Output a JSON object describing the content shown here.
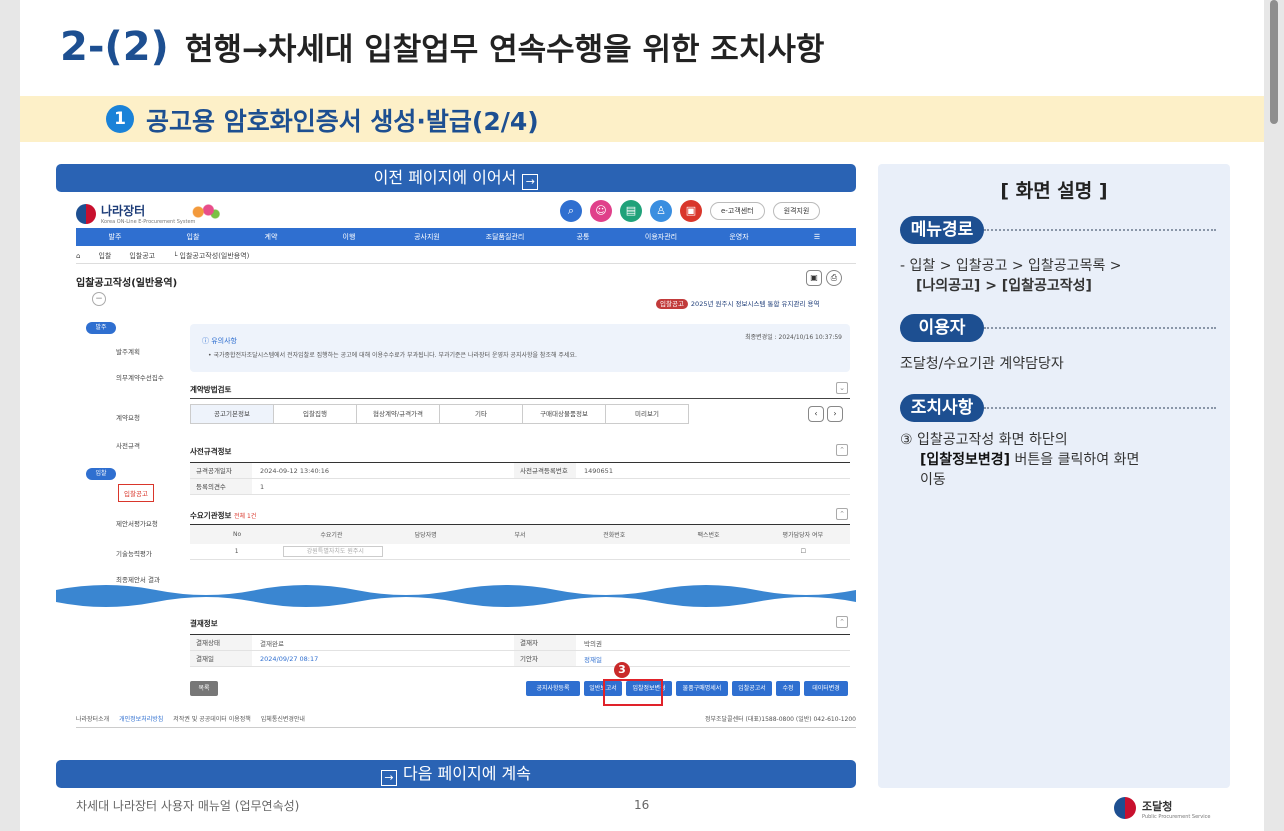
{
  "slide": {
    "number": "2-(2)",
    "title": "현행→차세대 입찰업무 연속수행을 위한 조치사항",
    "subtitle_badge": "1",
    "subtitle": "공고용 암호화인증서 생성·발급(2/4)",
    "banner_top": "이전 페이지에 이어서",
    "banner_top_icon": "→",
    "banner_bottom": "다음 페이지에 계속",
    "banner_bottom_icon": "→",
    "footer_left": "차세대 나라장터 사용자 매뉴얼 (업무연속성)",
    "page_number": "16",
    "footer_logo_name": "조달청",
    "footer_logo_sub": "Public Procurement Service"
  },
  "screen": {
    "logo_name": "나라장터",
    "logo_sub": "Korea ON-Line E-Procurement System",
    "top_pills": [
      "e-고객센터",
      "원격지원"
    ],
    "nav": [
      "발주",
      "입찰",
      "계약",
      "이행",
      "공사지원",
      "조달품질관리",
      "공통",
      "이용자관리",
      "운영자",
      "☰"
    ],
    "crumb": [
      "입찰",
      "입찰공고",
      "└ 입찰공고작성(일반용역)"
    ],
    "page_title": "입찰공고작성(일반용역)",
    "tag": "입찰공고",
    "tag_text": "2025년 원주시 정보시스템 통합 유지관리 용역",
    "sidebar": {
      "cat1": "발주",
      "items1": [
        "발주계획",
        "의무계약수선집수",
        "계약요청",
        "사전규격"
      ],
      "cat2": "입찰",
      "active": "입찰공고",
      "items2": [
        "제안서평가요청",
        "기술능력평가",
        "최종제안서 결과"
      ]
    },
    "notice_title": "유의사항",
    "notice_body": "• 국가종합전자조달시스템에서 전자입찰로 집행하는 공고에 대해 이용수수료가 부과됩니다. 부과기준은 나라장터 운영자 공지사항을 참조해 주세요.",
    "notice_date": "최종변경일 : 2024/10/16 10:37:59",
    "contract_section": "계약방법검토",
    "tabs": [
      "공고기본정보",
      "입찰집행",
      "협상계약/규격가격",
      "기타",
      "구매대상물품정보",
      "미리보기"
    ],
    "pre_section": "사전규격정보",
    "pre_rows": [
      {
        "k": "규격공개일자",
        "v": "2024-09-12 13:40:16",
        "k2": "사전규격등록번호",
        "v2": "1490651"
      },
      {
        "k": "등록의견수",
        "v": "1",
        "k2": "",
        "v2": ""
      }
    ],
    "demand_section": "수요기관정보",
    "demand_count": "전체 1건",
    "demand_headers": [
      "No",
      "수요기관",
      "담당자명",
      "부서",
      "전화번호",
      "팩스번호",
      "평가담당자 여부"
    ],
    "demand_row": [
      "1",
      "강원특별자치도 원주시",
      "",
      "",
      "",
      "",
      ""
    ],
    "approval_section": "결재정보",
    "approval_rows": [
      {
        "k": "결재상태",
        "v": "결재완료",
        "k2": "결재자",
        "v2": "박의권"
      },
      {
        "k": "결재일",
        "v": "2024/09/27 08:17",
        "k2": "기안자",
        "v2": "정재일"
      }
    ],
    "list_button": "목록",
    "action_buttons": [
      "공지사항등록",
      "일반보고서",
      "입찰정보변경",
      "물품구매명세서",
      "입찰공고서",
      "수정",
      "데이터변경"
    ],
    "highlight_number": "3",
    "footer_links": [
      "나라장터소개",
      "개인정보처리방침",
      "저작권 및 공공데이터 이용정책",
      "입체통신변경안내"
    ],
    "footer_right": "정부조달콜센터 (대표)1588-0800 (일반) 042-610-1200"
  },
  "panel": {
    "title": "[ 화면 설명 ]",
    "menu_tag": "메뉴경로",
    "menu_line1": "- 입찰 > 입찰공고 > 입찰공고목록 >",
    "menu_line2": "[나의공고] > [입찰공고작성]",
    "user_tag": "이용자",
    "user_text": "조달청/수요기관 계약담당자",
    "action_tag": "조치사항",
    "action_line1": "③ 입찰공고작성 화면 하단의",
    "action_bold": "[입찰정보변경]",
    "action_line2": " 버튼을 클릭하여 화면",
    "action_line3": "이동"
  }
}
